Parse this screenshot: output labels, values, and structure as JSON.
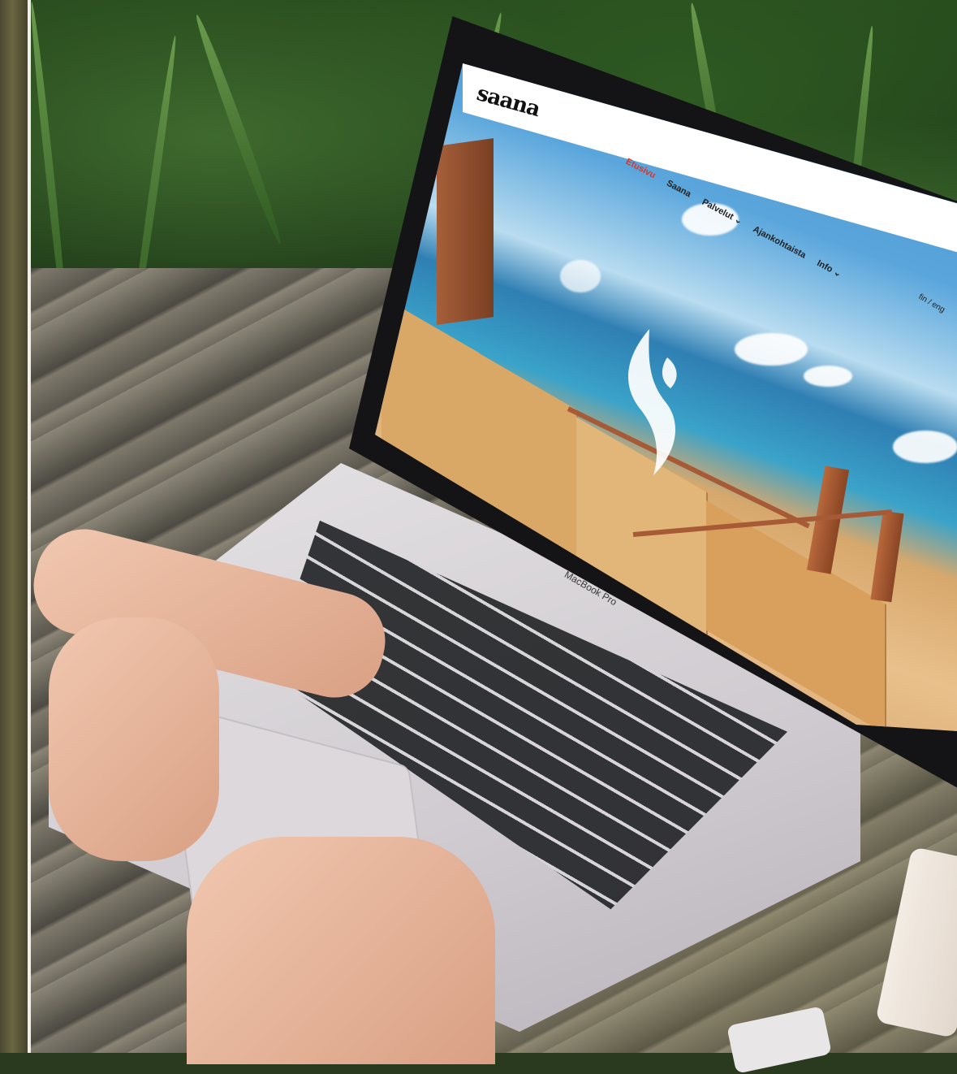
{
  "scene": {
    "description_labels": {
      "device": "laptop"
    }
  },
  "website": {
    "logo": "saana",
    "nav": [
      "Etusivu",
      "Saana",
      "Palvelut ⌄",
      "Ajankohtaista",
      "Info ⌄"
    ],
    "active_nav_index": 0,
    "language": "fin / eng"
  },
  "laptop": {
    "model_label": "MacBook Pro"
  },
  "colors": {
    "nav_active": "#d8352a",
    "header_bg": "#ffffff",
    "sky": "#3c89c9",
    "deck": "#d9a866"
  }
}
